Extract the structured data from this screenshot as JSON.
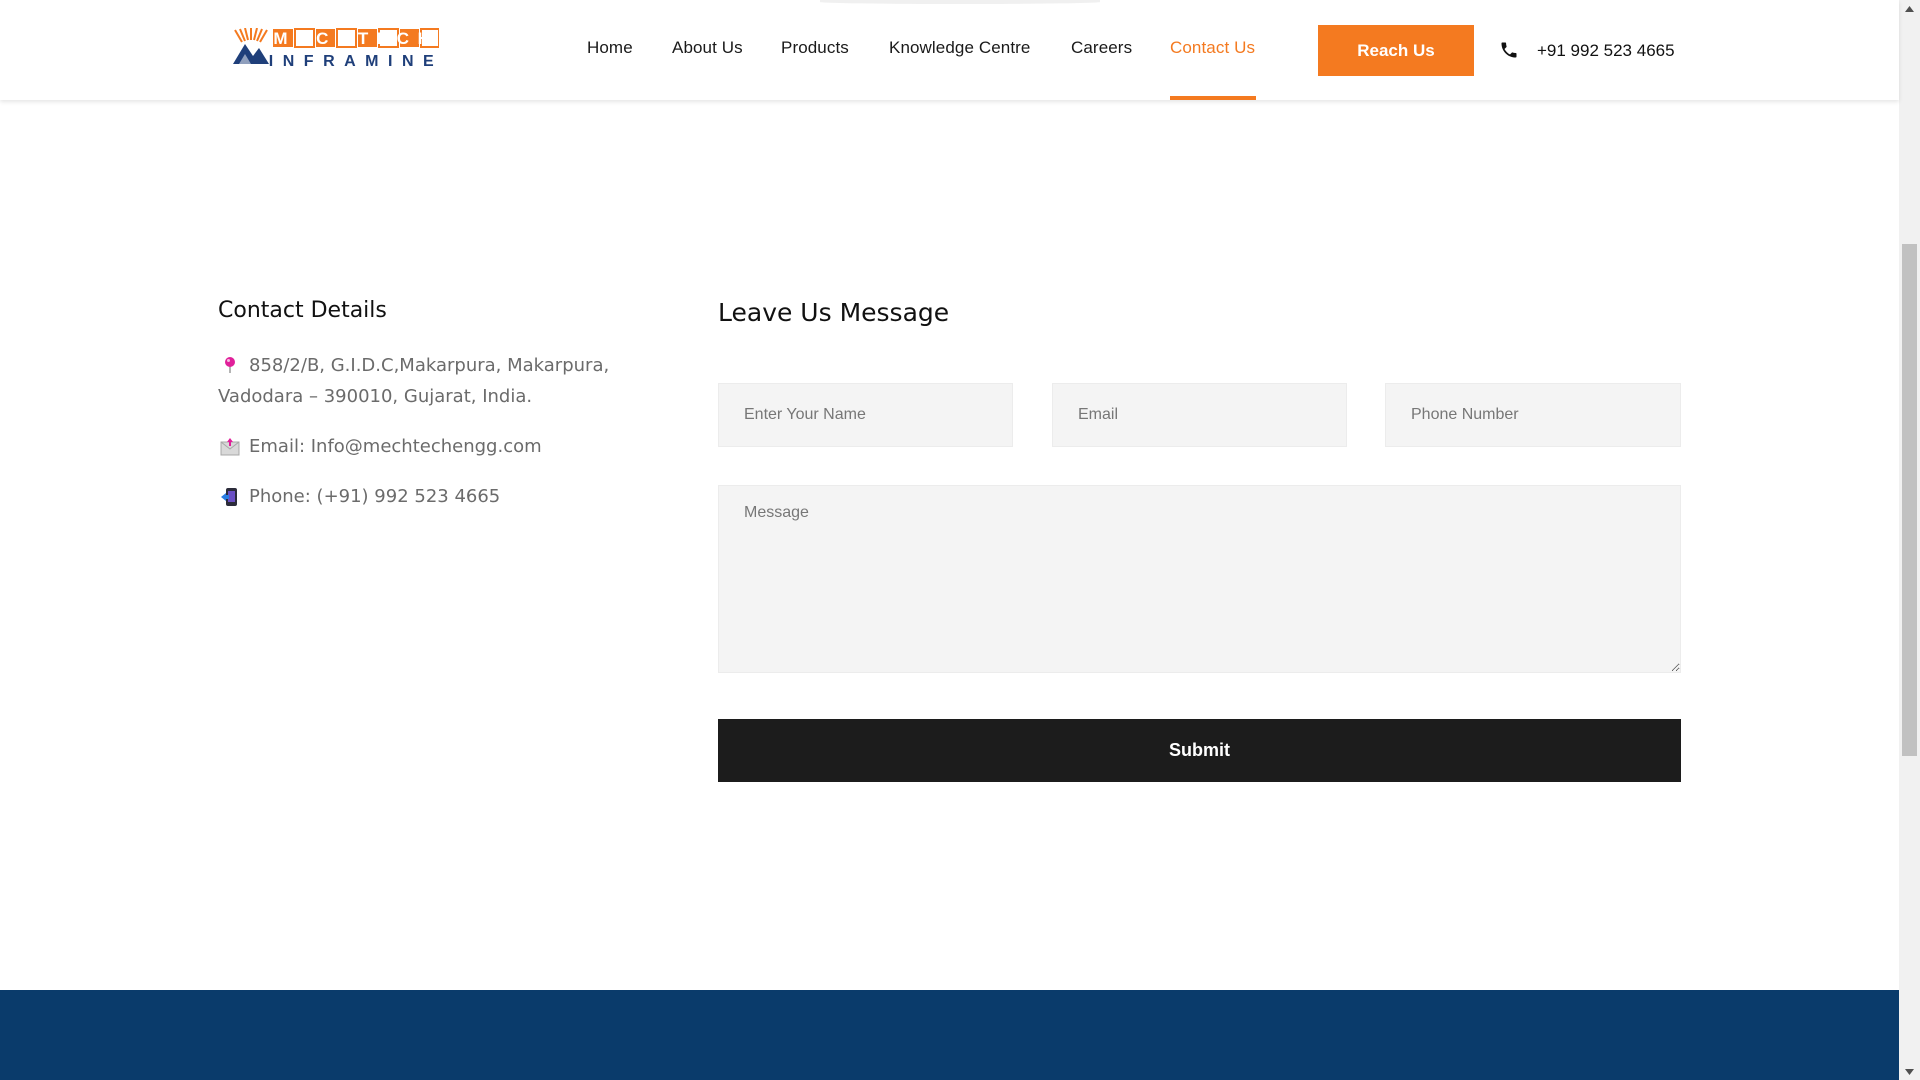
{
  "header": {
    "logo": {
      "icon": "mountain-rays-logo-icon",
      "line1": "MECHTECH",
      "line2": "INFRAMINE"
    },
    "nav": [
      {
        "label": "Home",
        "active": false
      },
      {
        "label": "About Us",
        "active": false
      },
      {
        "label": "Products",
        "active": false
      },
      {
        "label": "Knowledge Centre",
        "active": false
      },
      {
        "label": "Careers",
        "active": false
      },
      {
        "label": "Contact Us",
        "active": true
      }
    ],
    "cta_label": "Reach Us",
    "phone_icon": "phone-icon",
    "phone": "+91 992 523 4665"
  },
  "contact": {
    "title": "Contact Details",
    "address_icon": "location-pin-icon",
    "address_line1": "858/2/B, G.I.D.C,Makarpura, Makarpura,",
    "address_line2": "Vadodara – 390010, Gujarat, India.",
    "email_icon": "envelope-icon",
    "email": "Email: Info@mechtechengg.com",
    "phone_icon": "mobile-phone-icon",
    "phone": "Phone: (+91) 992 523 4665"
  },
  "form": {
    "title": "Leave Us Message",
    "name_placeholder": "Enter Your Name",
    "email_placeholder": "Email",
    "phone_placeholder": "Phone Number",
    "message_placeholder": "Message",
    "submit_label": "Submit"
  },
  "colors": {
    "accent": "#f47a20",
    "footer": "#0a3b6b",
    "submit": "#1c1c1c",
    "logo_blue": "#1f3f7a"
  }
}
